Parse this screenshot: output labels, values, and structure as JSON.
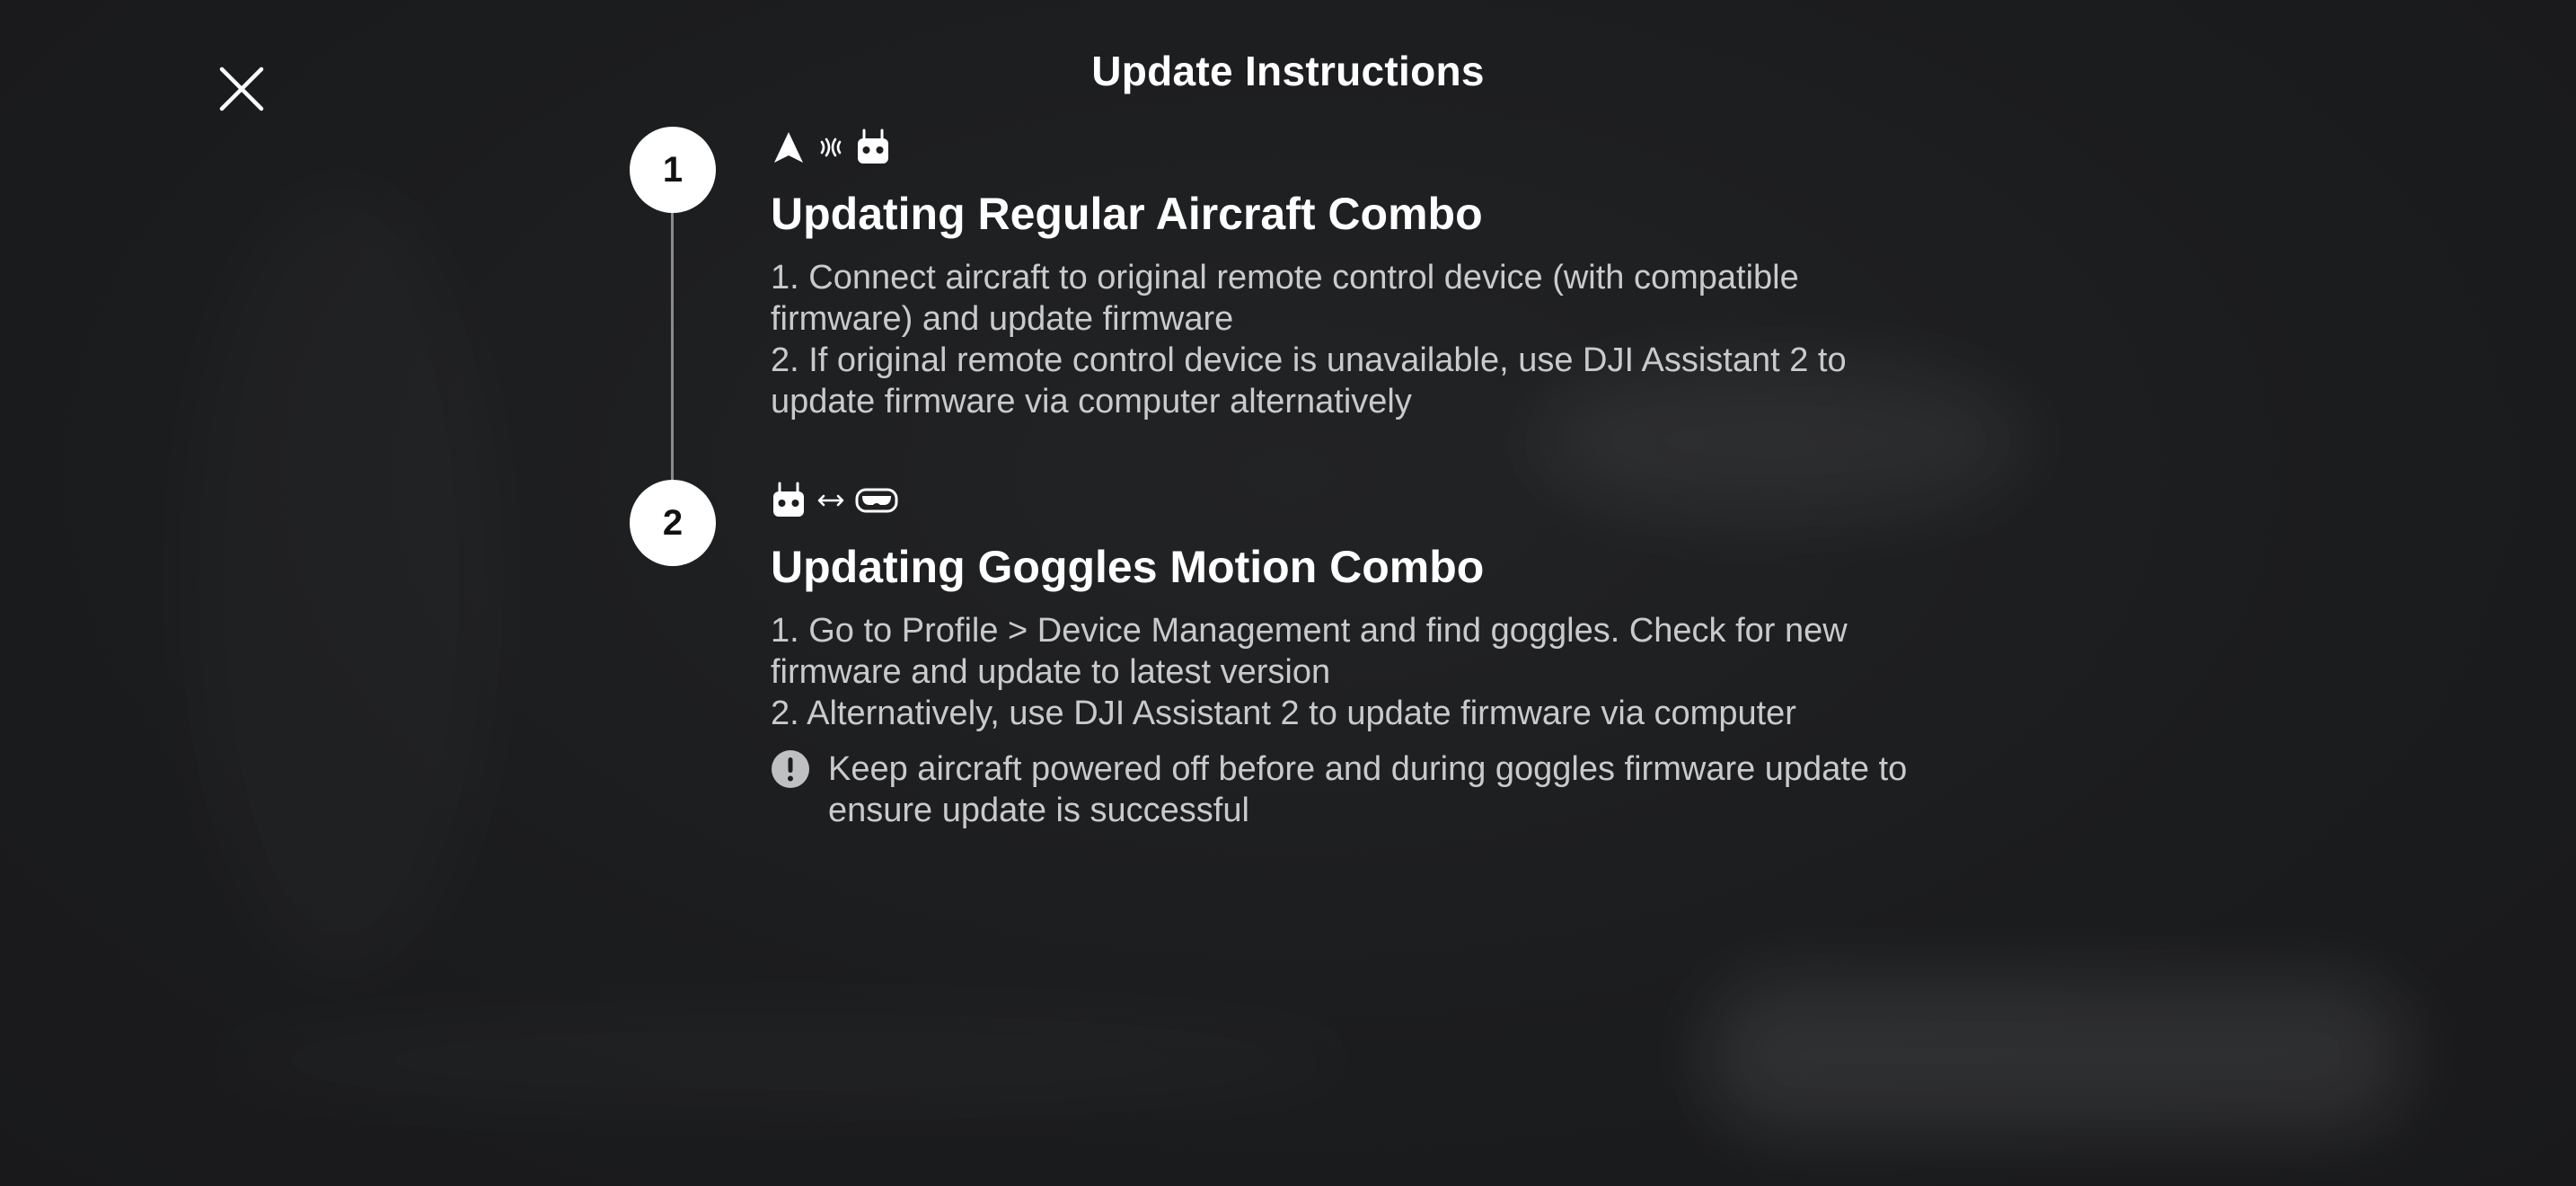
{
  "dialog": {
    "title": "Update Instructions",
    "close_icon": "close-icon"
  },
  "steps": [
    {
      "number": "1",
      "icons": [
        "aircraft-icon",
        "signal-icon",
        "remote-controller-icon"
      ],
      "heading": "Updating Regular Aircraft Combo",
      "lines": [
        "1. Connect aircraft to original remote control device (with compatible firmware) and update firmware",
        "2. If original remote control device is unavailable, use DJI Assistant 2 to update firmware via computer alternatively"
      ]
    },
    {
      "number": "2",
      "icons": [
        "remote-controller-icon",
        "link-arrows-icon",
        "goggles-icon"
      ],
      "heading": "Updating Goggles Motion Combo",
      "lines": [
        "1. Go to Profile > Device Management and find goggles. Check for new firmware and update to latest version",
        "2. Alternatively, use DJI Assistant 2 to update firmware via computer"
      ],
      "warning": {
        "icon": "warning-icon",
        "text": "Keep aircraft powered off before and during goggles firmware update to ensure update is successful"
      }
    }
  ]
}
